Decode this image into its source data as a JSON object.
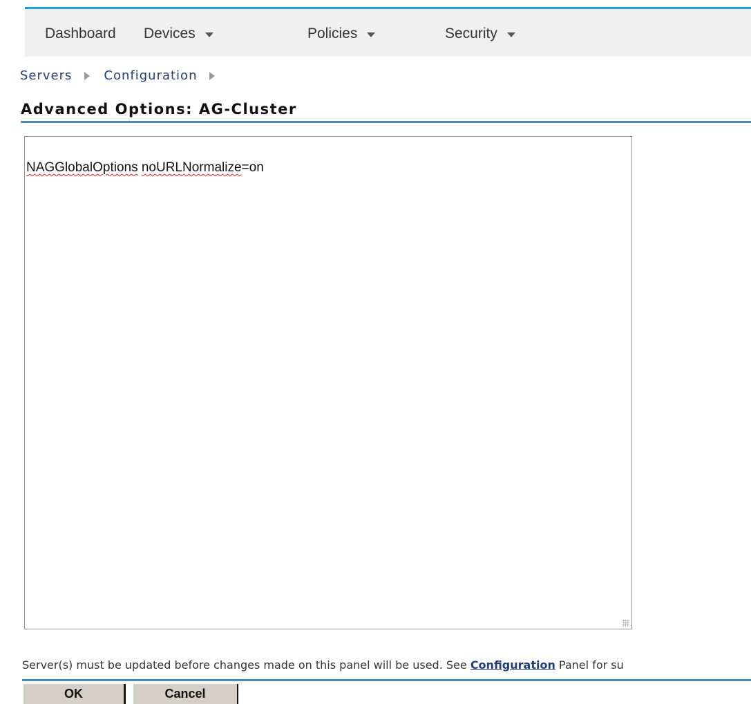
{
  "nav": {
    "items": [
      {
        "label": "Dashboard",
        "has_dropdown": false
      },
      {
        "label": "Devices",
        "has_dropdown": true
      },
      {
        "label": "Policies",
        "has_dropdown": true
      },
      {
        "label": "Security",
        "has_dropdown": true
      }
    ],
    "accent_color": "#1aa3d9"
  },
  "breadcrumb": {
    "items": [
      "Servers",
      "Configuration"
    ]
  },
  "page": {
    "title": "Advanced Options: AG-Cluster"
  },
  "editor": {
    "value_word1": "NAGGlobalOptions",
    "value_word2": "noURLNormalize",
    "value_rest": "=on"
  },
  "notice": {
    "text_before": "Server(s) must be updated before changes made on this panel will be used. See ",
    "link_text": "Configuration",
    "text_after": " Panel for su"
  },
  "buttons": {
    "ok_label": "OK",
    "cancel_label": "Cancel"
  },
  "colors": {
    "rule": "#4b8cbf",
    "link": "#1f3e7a",
    "button_bg": "#d4d0c8"
  }
}
